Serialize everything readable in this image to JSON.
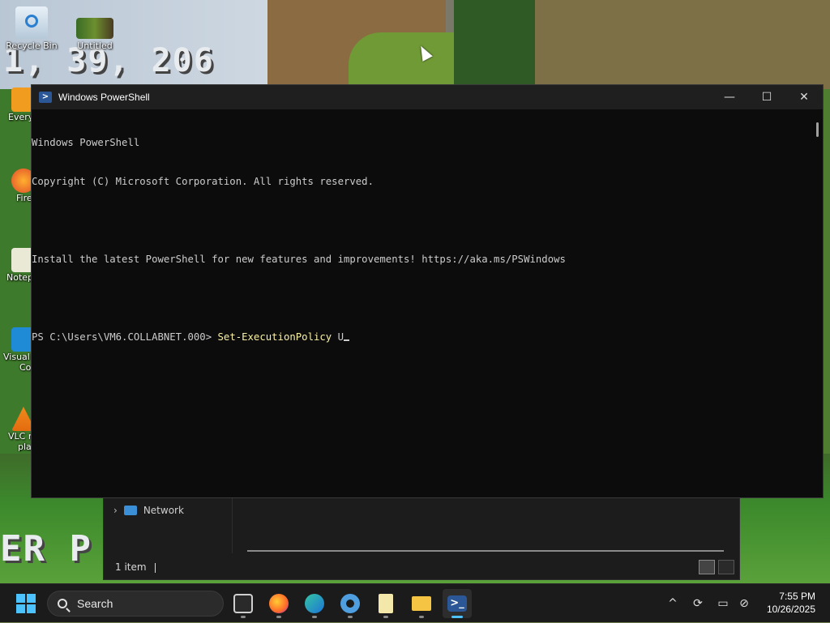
{
  "desktop": {
    "icons": [
      {
        "label": "Recycle Bin"
      },
      {
        "label": "Untitled"
      }
    ],
    "side_icons": [
      {
        "label": "Every"
      },
      {
        "label": "Fire"
      },
      {
        "label": "Notep"
      },
      {
        "label": "Visual"
      },
      {
        "label": "Co"
      },
      {
        "label": "VLC r"
      },
      {
        "label": "pla"
      }
    ],
    "wallpaper_text_top": "1, 39, 206",
    "wallpaper_text_bottom": "ER P"
  },
  "powershell": {
    "title": "Windows PowerShell",
    "controls": {
      "minimize": "—",
      "maximize": "☐",
      "close": "✕"
    },
    "lines": [
      "Windows PowerShell",
      "Copyright (C) Microsoft Corporation. All rights reserved.",
      "",
      "Install the latest PowerShell for new features and improvements! https://aka.ms/PSWindows",
      ""
    ],
    "prompt": "PS C:\\Users\\VM6.COLLABNET.000> ",
    "command": "Set-ExecutionPolicy",
    "argument": " U"
  },
  "explorer": {
    "nav_item": "Network",
    "status": "1 item"
  },
  "taskbar": {
    "search_placeholder": "Search",
    "apps": [
      {
        "icon": "task-view-icon"
      },
      {
        "icon": "firefox-icon"
      },
      {
        "icon": "edge-icon"
      },
      {
        "icon": "settings-icon"
      },
      {
        "icon": "notepad-icon"
      },
      {
        "icon": "file-explorer-icon"
      },
      {
        "icon": "powershell-icon"
      }
    ],
    "tray": {
      "chevron": "^",
      "time": "7:55 PM",
      "date": "10/26/2025"
    }
  },
  "colors": {
    "accent": "#4cc2ff",
    "console_bg": "#0c0c0c",
    "console_fg": "#cccccc",
    "command_yellow": "#f9f1a5"
  }
}
